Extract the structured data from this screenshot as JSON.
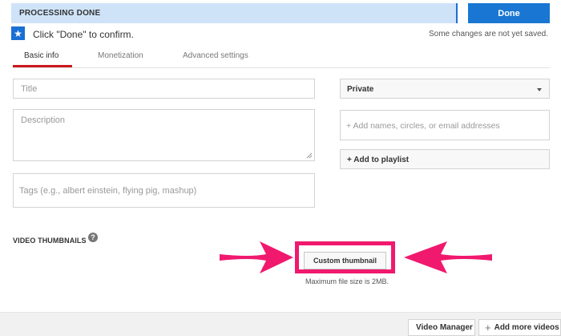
{
  "processing": {
    "status": "PROCESSING DONE",
    "done_label": "Done"
  },
  "confirm": {
    "message": "Click \"Done\" to confirm.",
    "unsaved_note": "Some changes are not yet saved."
  },
  "tabs": [
    {
      "label": "Basic info",
      "active": true
    },
    {
      "label": "Monetization",
      "active": false
    },
    {
      "label": "Advanced settings",
      "active": false
    }
  ],
  "form": {
    "title_placeholder": "Title",
    "description_placeholder": "Description",
    "tags_placeholder": "Tags (e.g., albert einstein, flying pig, mashup)",
    "privacy_value": "Private",
    "share_placeholder": "+ Add names, circles, or email addresses",
    "playlist_label": "+ Add to playlist"
  },
  "thumbnails": {
    "section_label": "VIDEO THUMBNAILS",
    "help_glyph": "?",
    "custom_button": "Custom thumbnail",
    "max_size_note": "Maximum file size is 2MB."
  },
  "footer": {
    "video_manager": "Video Manager",
    "add_more": "Add more videos",
    "add_more_glyph": "+"
  },
  "icons": {
    "confirm": "star-icon",
    "privacy_caret": "chevron-down-icon",
    "help": "help-icon"
  },
  "colors": {
    "accent_blue": "#1976d2",
    "bar_bg": "#cfe3f8",
    "highlight_pink": "#f0196e",
    "tab_red": "#cc181e"
  }
}
